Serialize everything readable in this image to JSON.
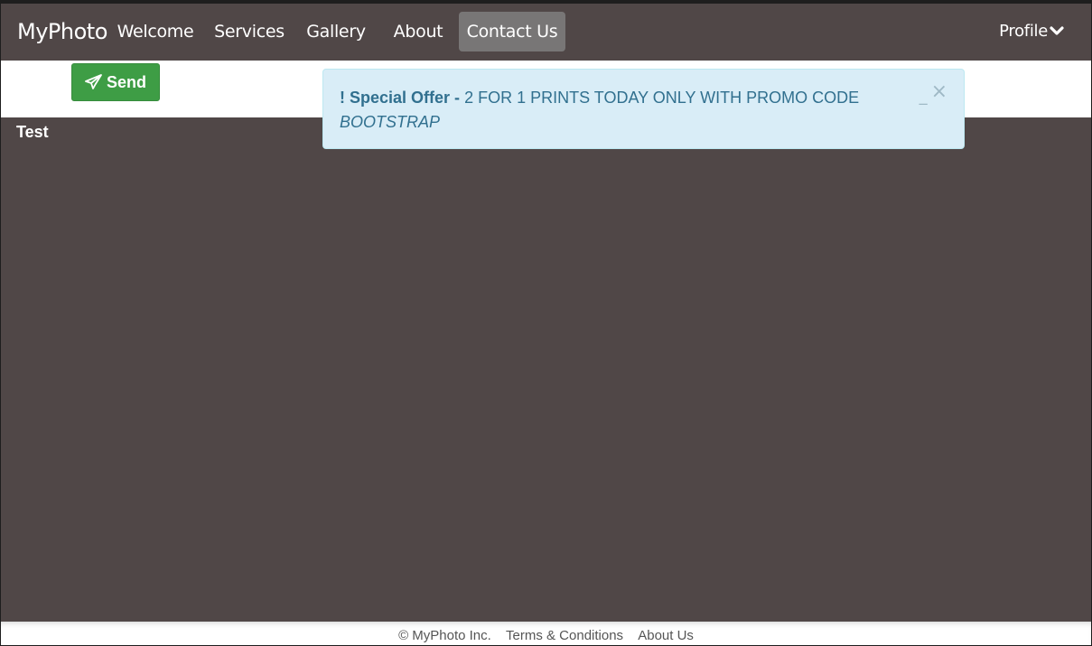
{
  "navbar": {
    "brand": "MyPhoto",
    "items": [
      {
        "label": "Welcome"
      },
      {
        "label": "Services"
      },
      {
        "label": "Gallery"
      },
      {
        "label": "About"
      },
      {
        "label": "Contact Us",
        "active": true
      }
    ],
    "profile_label": "Profile",
    "profile_icon": "chevron-down-icon"
  },
  "toolbar": {
    "send_label": "Send",
    "send_icon": "paper-plane-icon"
  },
  "main": {
    "title": "Test"
  },
  "alert": {
    "icon": "!",
    "label": "Special Offer -",
    "message": "2 FOR 1 PRINTS TODAY ONLY WITH PROMO CODE",
    "code": "BOOTSTRAP",
    "minimize_glyph": "_",
    "close_glyph": "×"
  },
  "footer": {
    "copyright": "© MyPhoto Inc.",
    "terms": "Terms & Conditions",
    "about": "About Us"
  },
  "colors": {
    "navbar_bg": "#504747",
    "active_item_bg": "#787676",
    "send_button": "#3e9d45",
    "alert_bg": "#d9edf7",
    "alert_text": "#31708f"
  }
}
